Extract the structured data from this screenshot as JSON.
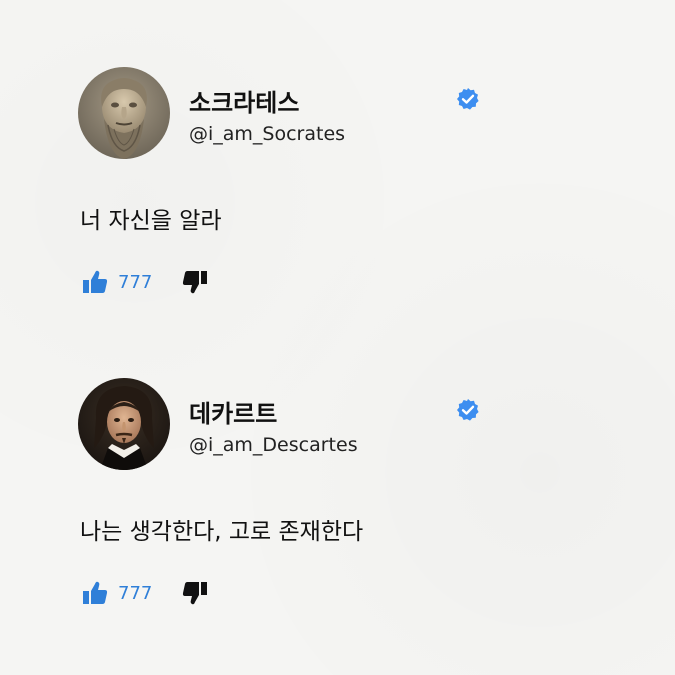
{
  "accent_color": "#2f7fd8",
  "posts": [
    {
      "name": "소크라테스",
      "handle": "@i_am_Socrates",
      "verified_icon": "verified-badge-icon",
      "text": "너 자신을 알라",
      "likes": "777",
      "like_icon": "thumbs-up-icon",
      "dislike_icon": "thumbs-down-icon"
    },
    {
      "name": "데카르트",
      "handle": "@i_am_Descartes",
      "verified_icon": "verified-badge-icon",
      "text": "나는 생각한다, 고로 존재한다",
      "likes": "777",
      "like_icon": "thumbs-up-icon",
      "dislike_icon": "thumbs-down-icon"
    }
  ]
}
